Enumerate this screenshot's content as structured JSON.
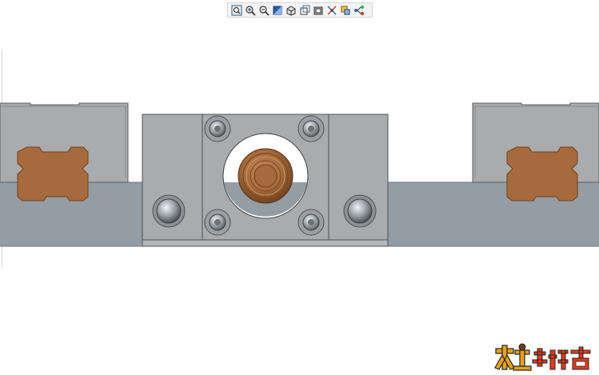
{
  "toolbar": {
    "buttons": [
      {
        "name": "zoom-fit-button",
        "icon": "zoom-fit-icon",
        "tooltip": ""
      },
      {
        "name": "zoom-in-button",
        "icon": "zoom-in-icon",
        "tooltip": ""
      },
      {
        "name": "zoom-out-button",
        "icon": "zoom-out-icon",
        "tooltip": ""
      },
      {
        "name": "view-orientation-button",
        "icon": "view-orientation-icon",
        "tooltip": ""
      },
      {
        "name": "display-style-button",
        "icon": "display-style-icon",
        "tooltip": ""
      },
      {
        "name": "saved-views-button",
        "icon": "saved-views-icon",
        "tooltip": ""
      },
      {
        "name": "section-view-button",
        "icon": "section-view-icon",
        "tooltip": ""
      },
      {
        "name": "datum-display-button",
        "icon": "datum-display-icon",
        "tooltip": ""
      },
      {
        "name": "appearance-button",
        "icon": "appearance-icon",
        "tooltip": ""
      },
      {
        "name": "view-manager-button",
        "icon": "view-manager-icon",
        "tooltip": ""
      }
    ]
  },
  "colors": {
    "steel_light": "#a9abad",
    "steel_dark": "#6e7074",
    "rail_blue": "#949ca4",
    "bronze": "#a66a3c",
    "bronze_dark": "#7a4a22",
    "background": "#ffffff"
  },
  "watermark": {
    "text": "木工爱好者"
  }
}
